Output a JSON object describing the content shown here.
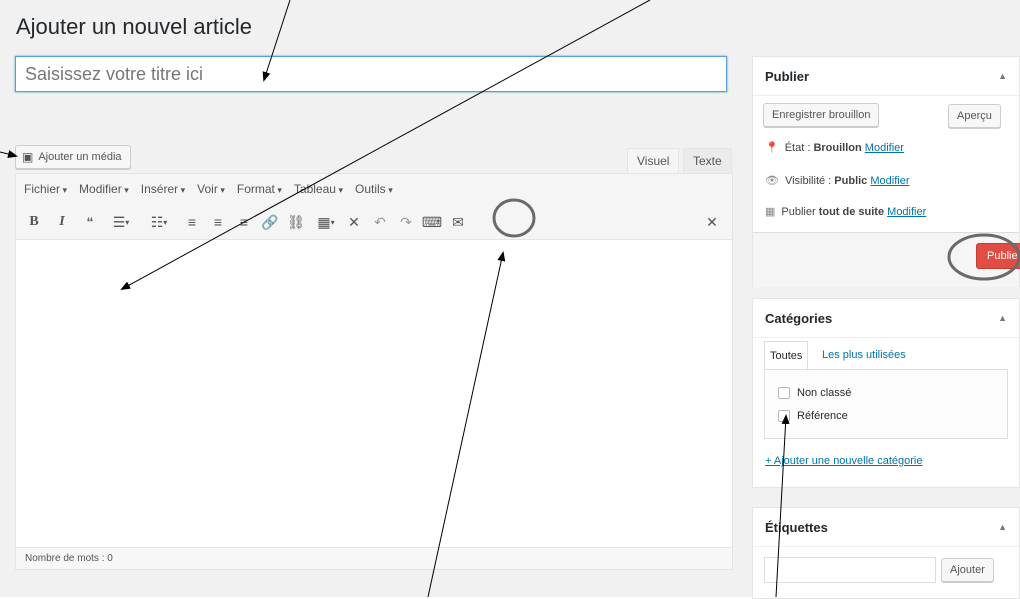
{
  "page": {
    "title": "Ajouter un nouvel article"
  },
  "title_field": {
    "placeholder": "Saisissez votre titre ici",
    "value": ""
  },
  "editor": {
    "media_button": "Ajouter un média",
    "tabs": {
      "visual": "Visuel",
      "text": "Texte"
    },
    "menu": [
      "Fichier",
      "Modifier",
      "Insérer",
      "Voir",
      "Format",
      "Tableau",
      "Outils"
    ],
    "toolbar_icons": [
      "bold-icon",
      "italic-icon",
      "blockquote-icon",
      "bullet-list-icon",
      "numbered-list-icon",
      "align-left-icon",
      "align-center-icon",
      "align-right-icon",
      "link-icon",
      "unlink-icon",
      "table-icon",
      "fullscreen-icon",
      "undo-icon",
      "redo-icon",
      "keyboard-icon",
      "mail-icon",
      "distraction-free-icon"
    ],
    "word_count": "Nombre de mots : 0"
  },
  "publish_box": {
    "title": "Publier",
    "save_draft": "Enregistrer brouillon",
    "preview": "Aperçu",
    "status_label": "État : ",
    "status_value": "Brouillon",
    "visibility_label": "Visibilité : ",
    "visibility_value": "Public",
    "schedule_label": "Publier ",
    "schedule_value": "tout de suite",
    "edit_link": "Modifier",
    "publish_button": "Publier"
  },
  "categories_box": {
    "title": "Catégories",
    "tab_all": "Toutes",
    "tab_popular": "Les plus utilisées",
    "items": [
      "Non classé",
      "Référence"
    ],
    "add_link": "+ Ajouter une nouvelle catégorie"
  },
  "tags_box": {
    "title": "Étiquettes",
    "add_button": "Ajouter"
  },
  "colors": {
    "accent": "#0073aa",
    "publish": "#e14d43",
    "highlight": "#5b9dd9"
  }
}
